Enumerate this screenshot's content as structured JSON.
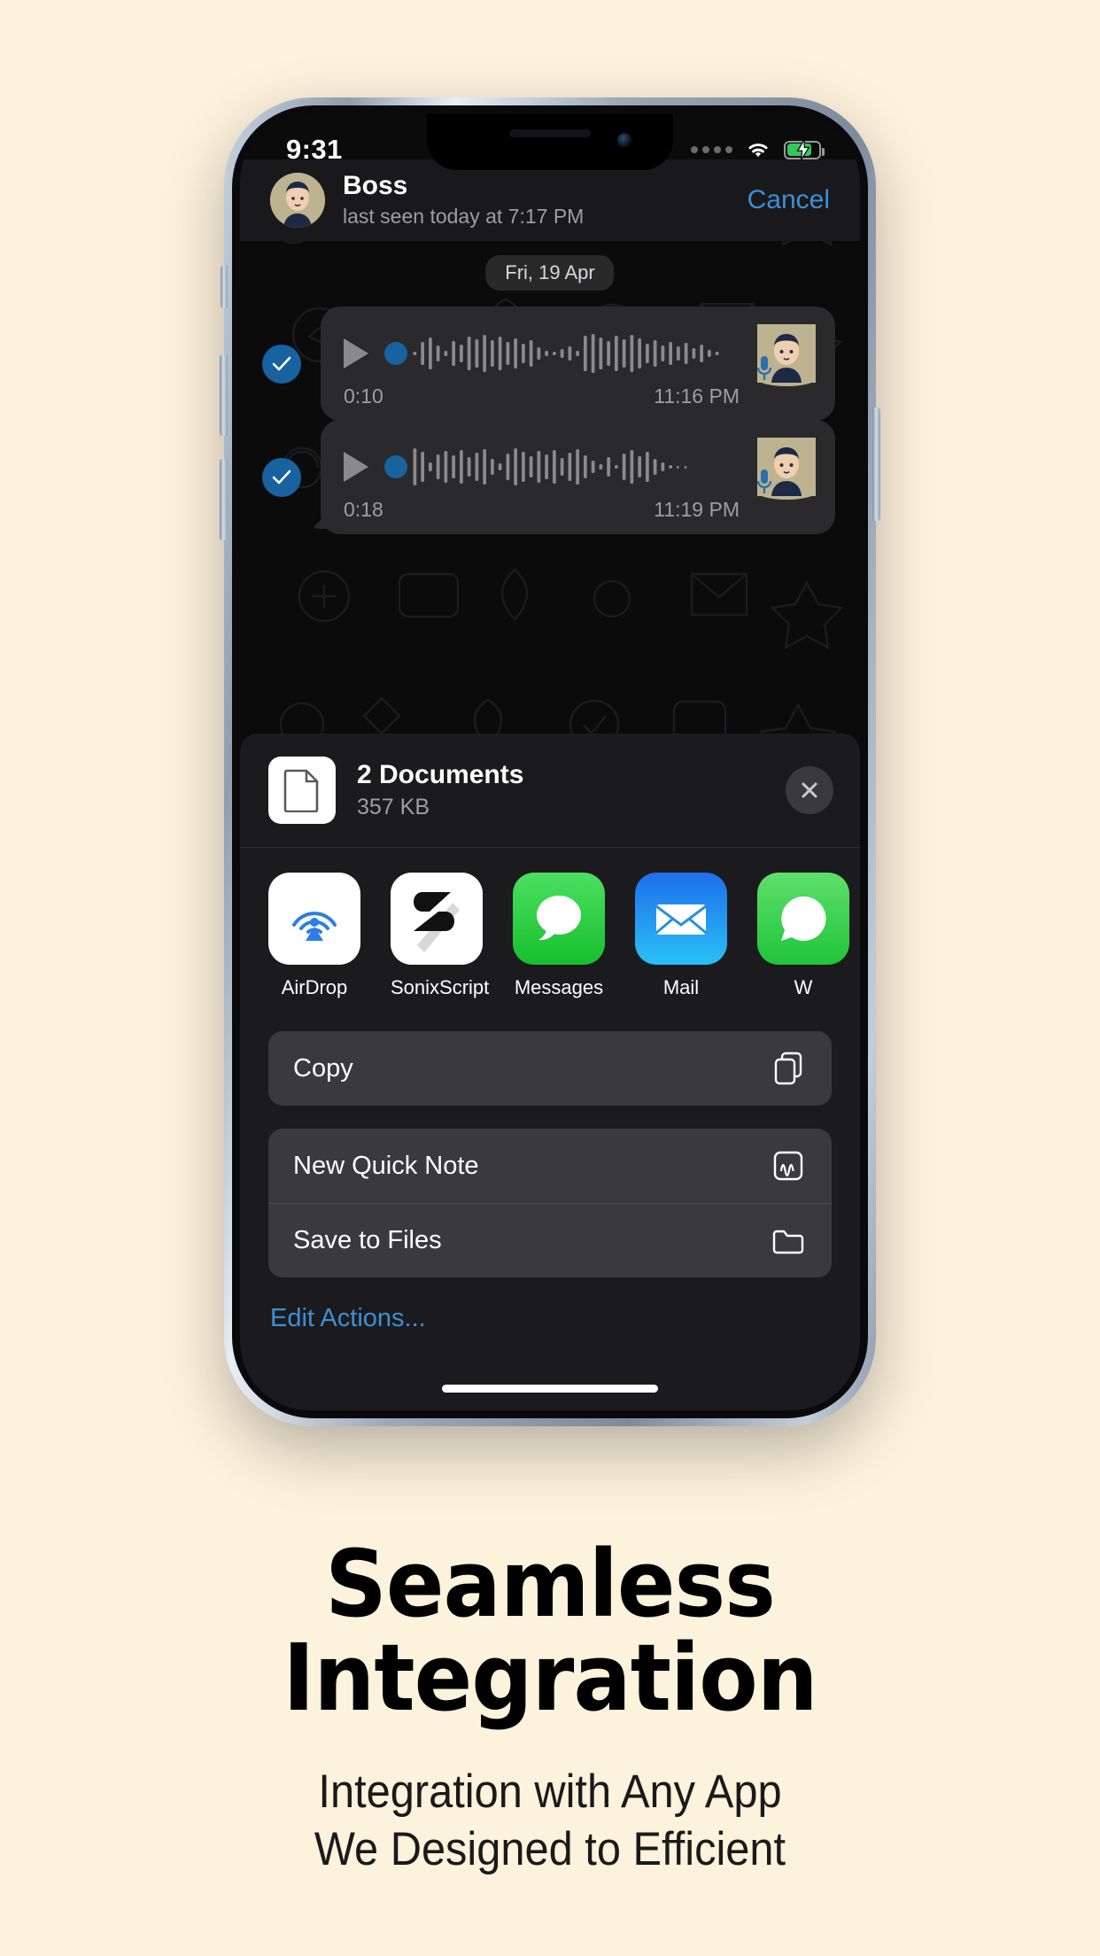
{
  "background_color": "#FDF2DC",
  "accent_blue": "#3d8fd6",
  "statusbar": {
    "time": "9:31",
    "cellular_icon": "cellular-dots-icon",
    "wifi_icon": "wifi-icon",
    "battery_icon": "battery-charging-icon",
    "battery_color": "#34C759"
  },
  "chat": {
    "header": {
      "avatar": "contact-avatar",
      "name": "Boss",
      "status": "last seen today at 7:17 PM",
      "cancel_label": "Cancel"
    },
    "date_separator": "Fri, 19 Apr",
    "messages": [
      {
        "selected": true,
        "duration": "0:10",
        "time": "11:16 PM",
        "play_icon": "play-icon",
        "mic_icon": "microphone-icon"
      },
      {
        "selected": true,
        "duration": "0:18",
        "time": "11:19 PM",
        "play_icon": "play-icon",
        "mic_icon": "microphone-icon"
      }
    ]
  },
  "share_sheet": {
    "doc_icon": "document-icon",
    "title": "2 Documents",
    "size": "357 KB",
    "close_icon": "close-icon",
    "apps": [
      {
        "label": "AirDrop",
        "icon": "airdrop-icon",
        "bg": "#FFFFFF"
      },
      {
        "label": "SonixScript",
        "icon": "sonixscript-icon",
        "bg": "#FFFFFF"
      },
      {
        "label": "Messages",
        "icon": "messages-icon",
        "bg": "#34C759"
      },
      {
        "label": "Mail",
        "icon": "mail-icon",
        "bg": "#1E90FF"
      },
      {
        "label": "W",
        "icon": "whatsapp-icon",
        "bg": "#4ADE5C"
      }
    ],
    "actions_group_1": [
      {
        "label": "Copy",
        "icon": "copy-icon"
      }
    ],
    "actions_group_2": [
      {
        "label": "New Quick Note",
        "icon": "quick-note-icon"
      },
      {
        "label": "Save to Files",
        "icon": "folder-icon"
      }
    ],
    "edit_actions_label": "Edit Actions..."
  },
  "caption": {
    "headline_line1": "Seamless",
    "headline_line2": "Integration",
    "subline_line1": "Integration with Any App",
    "subline_line2": "We Designed to Efficient"
  }
}
